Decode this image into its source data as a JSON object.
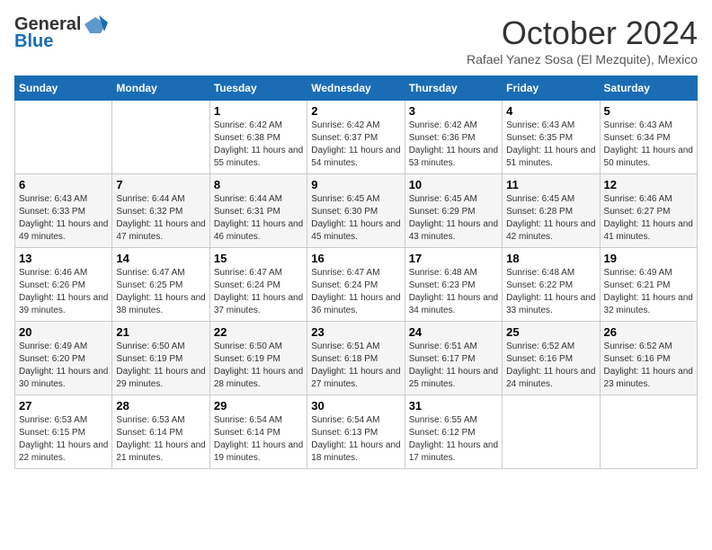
{
  "logo": {
    "general": "General",
    "blue": "Blue"
  },
  "header": {
    "month": "October 2024",
    "location": "Rafael Yanez Sosa (El Mezquite), Mexico"
  },
  "weekdays": [
    "Sunday",
    "Monday",
    "Tuesday",
    "Wednesday",
    "Thursday",
    "Friday",
    "Saturday"
  ],
  "weeks": [
    [
      {
        "day": "",
        "info": ""
      },
      {
        "day": "",
        "info": ""
      },
      {
        "day": "1",
        "info": "Sunrise: 6:42 AM\nSunset: 6:38 PM\nDaylight: 11 hours and 55 minutes."
      },
      {
        "day": "2",
        "info": "Sunrise: 6:42 AM\nSunset: 6:37 PM\nDaylight: 11 hours and 54 minutes."
      },
      {
        "day": "3",
        "info": "Sunrise: 6:42 AM\nSunset: 6:36 PM\nDaylight: 11 hours and 53 minutes."
      },
      {
        "day": "4",
        "info": "Sunrise: 6:43 AM\nSunset: 6:35 PM\nDaylight: 11 hours and 51 minutes."
      },
      {
        "day": "5",
        "info": "Sunrise: 6:43 AM\nSunset: 6:34 PM\nDaylight: 11 hours and 50 minutes."
      }
    ],
    [
      {
        "day": "6",
        "info": "Sunrise: 6:43 AM\nSunset: 6:33 PM\nDaylight: 11 hours and 49 minutes."
      },
      {
        "day": "7",
        "info": "Sunrise: 6:44 AM\nSunset: 6:32 PM\nDaylight: 11 hours and 47 minutes."
      },
      {
        "day": "8",
        "info": "Sunrise: 6:44 AM\nSunset: 6:31 PM\nDaylight: 11 hours and 46 minutes."
      },
      {
        "day": "9",
        "info": "Sunrise: 6:45 AM\nSunset: 6:30 PM\nDaylight: 11 hours and 45 minutes."
      },
      {
        "day": "10",
        "info": "Sunrise: 6:45 AM\nSunset: 6:29 PM\nDaylight: 11 hours and 43 minutes."
      },
      {
        "day": "11",
        "info": "Sunrise: 6:45 AM\nSunset: 6:28 PM\nDaylight: 11 hours and 42 minutes."
      },
      {
        "day": "12",
        "info": "Sunrise: 6:46 AM\nSunset: 6:27 PM\nDaylight: 11 hours and 41 minutes."
      }
    ],
    [
      {
        "day": "13",
        "info": "Sunrise: 6:46 AM\nSunset: 6:26 PM\nDaylight: 11 hours and 39 minutes."
      },
      {
        "day": "14",
        "info": "Sunrise: 6:47 AM\nSunset: 6:25 PM\nDaylight: 11 hours and 38 minutes."
      },
      {
        "day": "15",
        "info": "Sunrise: 6:47 AM\nSunset: 6:24 PM\nDaylight: 11 hours and 37 minutes."
      },
      {
        "day": "16",
        "info": "Sunrise: 6:47 AM\nSunset: 6:24 PM\nDaylight: 11 hours and 36 minutes."
      },
      {
        "day": "17",
        "info": "Sunrise: 6:48 AM\nSunset: 6:23 PM\nDaylight: 11 hours and 34 minutes."
      },
      {
        "day": "18",
        "info": "Sunrise: 6:48 AM\nSunset: 6:22 PM\nDaylight: 11 hours and 33 minutes."
      },
      {
        "day": "19",
        "info": "Sunrise: 6:49 AM\nSunset: 6:21 PM\nDaylight: 11 hours and 32 minutes."
      }
    ],
    [
      {
        "day": "20",
        "info": "Sunrise: 6:49 AM\nSunset: 6:20 PM\nDaylight: 11 hours and 30 minutes."
      },
      {
        "day": "21",
        "info": "Sunrise: 6:50 AM\nSunset: 6:19 PM\nDaylight: 11 hours and 29 minutes."
      },
      {
        "day": "22",
        "info": "Sunrise: 6:50 AM\nSunset: 6:19 PM\nDaylight: 11 hours and 28 minutes."
      },
      {
        "day": "23",
        "info": "Sunrise: 6:51 AM\nSunset: 6:18 PM\nDaylight: 11 hours and 27 minutes."
      },
      {
        "day": "24",
        "info": "Sunrise: 6:51 AM\nSunset: 6:17 PM\nDaylight: 11 hours and 25 minutes."
      },
      {
        "day": "25",
        "info": "Sunrise: 6:52 AM\nSunset: 6:16 PM\nDaylight: 11 hours and 24 minutes."
      },
      {
        "day": "26",
        "info": "Sunrise: 6:52 AM\nSunset: 6:16 PM\nDaylight: 11 hours and 23 minutes."
      }
    ],
    [
      {
        "day": "27",
        "info": "Sunrise: 6:53 AM\nSunset: 6:15 PM\nDaylight: 11 hours and 22 minutes."
      },
      {
        "day": "28",
        "info": "Sunrise: 6:53 AM\nSunset: 6:14 PM\nDaylight: 11 hours and 21 minutes."
      },
      {
        "day": "29",
        "info": "Sunrise: 6:54 AM\nSunset: 6:14 PM\nDaylight: 11 hours and 19 minutes."
      },
      {
        "day": "30",
        "info": "Sunrise: 6:54 AM\nSunset: 6:13 PM\nDaylight: 11 hours and 18 minutes."
      },
      {
        "day": "31",
        "info": "Sunrise: 6:55 AM\nSunset: 6:12 PM\nDaylight: 11 hours and 17 minutes."
      },
      {
        "day": "",
        "info": ""
      },
      {
        "day": "",
        "info": ""
      }
    ]
  ]
}
